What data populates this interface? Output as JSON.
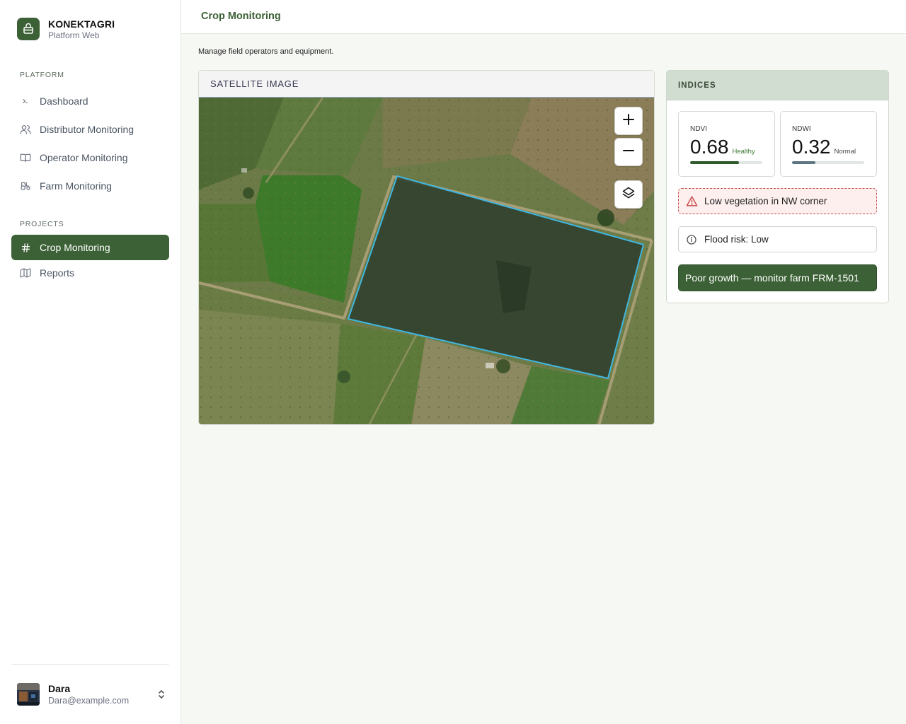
{
  "brand": {
    "name": "KONEKTAGRI",
    "subtitle": "Platform Web"
  },
  "sidebar": {
    "platform_label": "PLATFORM",
    "platform_items": [
      {
        "label": "Dashboard",
        "icon": "terminal-icon"
      },
      {
        "label": "Distributor Monitoring",
        "icon": "users-icon"
      },
      {
        "label": "Operator Monitoring",
        "icon": "book-icon"
      },
      {
        "label": "Farm Monitoring",
        "icon": "tractor-icon"
      }
    ],
    "projects_label": "PROJECTS",
    "project_items": [
      {
        "label": "Crop Monitoring",
        "icon": "hash-icon",
        "active": true
      },
      {
        "label": "Reports",
        "icon": "map-icon",
        "active": false
      }
    ]
  },
  "user": {
    "name": "Dara",
    "email": "Dara@example.com"
  },
  "header": {
    "title": "Crop Monitoring"
  },
  "page": {
    "description": "Manage field operators and equipment."
  },
  "satellite": {
    "title": "SATELLITE IMAGE",
    "controls": {
      "zoom_in": "zoom-in-icon",
      "zoom_out": "zoom-out-icon",
      "layers": "layers-icon"
    },
    "boundary_color": "#3fb6e0"
  },
  "indices": {
    "title": "INDICES",
    "metrics": [
      {
        "label": "NDVI",
        "value": "0.68",
        "status": "Healthy",
        "level": 0.68,
        "color": "#2f5a2a",
        "status_color": "#3a7a30"
      },
      {
        "label": "NDWI",
        "value": "0.32",
        "status": "Normal",
        "level": 0.32,
        "color": "#5d7683",
        "status_color": "#444444"
      }
    ],
    "alerts": [
      {
        "text": "Low vegetation in NW corner",
        "icon": "warning-triangle-icon",
        "kind": "warning"
      },
      {
        "text": "Flood risk: Low",
        "icon": "info-circle-icon",
        "kind": "info"
      }
    ],
    "action": {
      "label": "Poor growth — monitor farm FRM-1501"
    }
  },
  "colors": {
    "accent": "#3c6136",
    "warning": "#c94a4a"
  }
}
